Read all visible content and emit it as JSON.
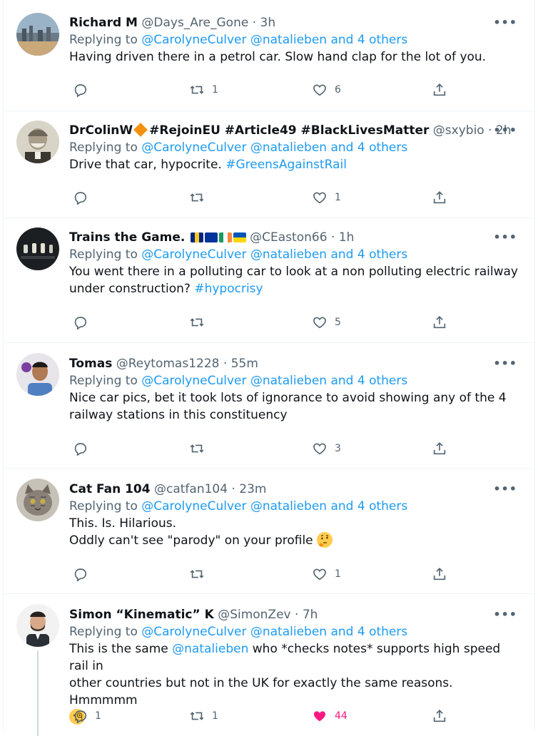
{
  "common": {
    "replying_to": "Replying to",
    "mention1": "@CarolyneCulver",
    "mention2": "@natalieben",
    "and": "and",
    "others": "4 others",
    "separator": "·",
    "more": "•••"
  },
  "tweets": [
    {
      "name": "Richard M",
      "handle": "@Days_Are_Gone",
      "time": "3h",
      "text": [
        "Having driven there in a petrol car. Slow hand clap for the lot of you."
      ],
      "replies": "",
      "retweets": "1",
      "likes": "6"
    },
    {
      "name": "DrColinW",
      "name_tags": "#RejoinEU #Article49 #BlackLivesMatter",
      "handle": "@sxybio",
      "time": "2h",
      "text_plain": "Drive that car, hypocrite.",
      "hashtag": "#GreensAgainstRail",
      "replies": "",
      "retweets": "",
      "likes": "1"
    },
    {
      "name": "Trains the Game.",
      "handle": "@CEaston66",
      "time": "1h",
      "text_line1": "You went there in a polluting car to look at a non polluting electric railway",
      "text_line2": "under construction?",
      "hashtag": "#hypocrisy",
      "replies": "",
      "retweets": "",
      "likes": "5"
    },
    {
      "name": "Tomas",
      "handle": "@Reytomas1228",
      "time": "55m",
      "text": [
        "Nice car pics, bet it took lots of ignorance to avoid showing any of the 4",
        "railway stations in this constituency"
      ],
      "replies": "",
      "retweets": "",
      "likes": "3"
    },
    {
      "name": "Cat Fan 104",
      "handle": "@catfan104",
      "time": "23m",
      "text": [
        "This. Is. Hilarious.",
        "Oddly can't see \"parody\" on your profile"
      ],
      "emoji": "thinking-face",
      "replies": "",
      "retweets": "",
      "likes": "1"
    },
    {
      "name": "Simon “Kinematic” K",
      "handle": "@SimonZev",
      "time": "7h",
      "text_pre": "This is the same",
      "text_mention": "@natalieben",
      "text_post": "who *checks notes* supports high speed rail in",
      "text_line2": "other countries but not in the UK for exactly the same reasons. Hmmmmm",
      "emoji": "face-with-monocle",
      "replies": "1",
      "retweets": "1",
      "likes": "44",
      "liked": true
    }
  ],
  "colors": {
    "link": "#1d9bf0",
    "muted": "#536471",
    "like_active": "#f91880",
    "divider": "#eff3f4"
  }
}
